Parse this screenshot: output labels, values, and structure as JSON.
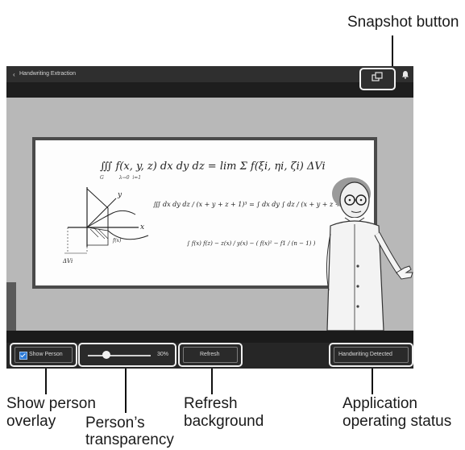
{
  "callouts": {
    "snapshot": "Snapshot button",
    "show_person": [
      "Show person",
      "overlay"
    ],
    "transparency": [
      "Person’s",
      "transparency"
    ],
    "refresh": [
      "Refresh",
      "background"
    ],
    "status": [
      "Application",
      "operating status"
    ]
  },
  "window": {
    "back_icon": "chevron-left-icon",
    "title": "Handwriting Extraction",
    "snapshot_icon": "camera-icon",
    "notification_icon": "bell-icon"
  },
  "board": {
    "eq1": "∭ f(x, y, z) dx dy dz = lim Σ f(ξi, ηi, ζi) ΔVi",
    "eq1_sub": "G          λ→0  i=1",
    "eq2": "∭ dx dy dz / (x + y + z + 1)³ = ∫ dx dy ∫ dz / (x + y + z + 1)³",
    "eq3": "∫ f(x) f(z) − z(x) / y(x) − ( f(x)² − f1 / (n − 1) )",
    "delta_label": "ΔVi",
    "axis_x": "x",
    "axis_y": "y",
    "curve_label": "f(x)"
  },
  "controls": {
    "show_person": {
      "label": "Show Person",
      "checked": true
    },
    "transparency": {
      "value": "30%",
      "level": 0.3
    },
    "refresh": {
      "label": "Refresh"
    },
    "status": {
      "label": "Handwriting Detected"
    }
  },
  "colors": {
    "accent": "#2d7ad6",
    "highlight_border": "#f0f0f0",
    "app_bg": "#2b2b2b"
  }
}
